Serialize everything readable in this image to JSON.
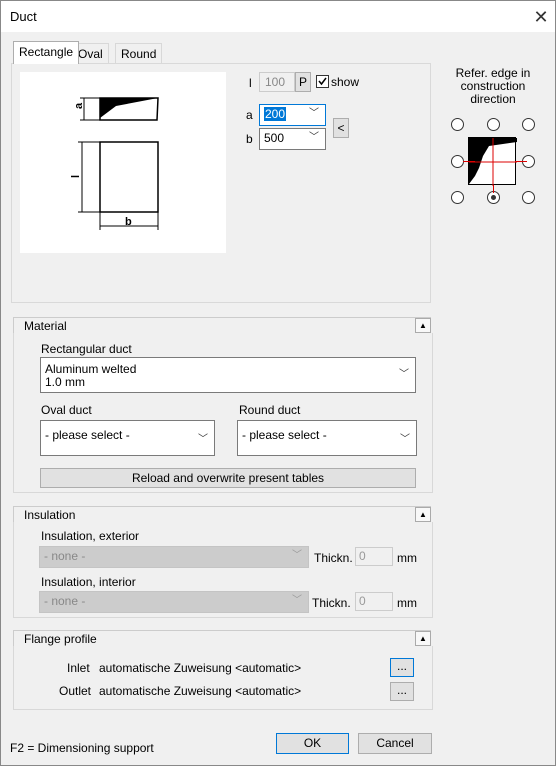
{
  "window": {
    "title": "Duct",
    "close_icon": "close-icon"
  },
  "tabs": [
    {
      "label": "Rectangle",
      "active": true
    },
    {
      "label": "Oval",
      "active": false
    },
    {
      "label": "Round",
      "active": false
    }
  ],
  "dimensions": {
    "l_label": "l",
    "l_value": "100",
    "p_button": "P",
    "show_label": "show",
    "show_checked": true,
    "a_label": "a",
    "a_value": "200",
    "b_label": "b",
    "b_value": "500",
    "swap_button": "<"
  },
  "diagram": {
    "label_a": "a",
    "label_l": "l",
    "label_b": "b"
  },
  "reference": {
    "title": "Refer. edge in construction direction",
    "selected": "bottom-center"
  },
  "material": {
    "title": "Material",
    "rect_label": "Rectangular duct",
    "rect_value_line1": "Aluminum welted",
    "rect_value_line2": "1.0 mm",
    "oval_label": "Oval duct",
    "oval_value": "- please select -",
    "round_label": "Round duct",
    "round_value": "- please select -",
    "reload_button": "Reload and overwrite present tables"
  },
  "insulation": {
    "title": "Insulation",
    "exterior_label": "Insulation, exterior",
    "exterior_value": "- none -",
    "exterior_thickn_label": "Thickn.",
    "exterior_thickn_value": "0",
    "exterior_unit": "mm",
    "interior_label": "Insulation, interior",
    "interior_value": "- none -",
    "interior_thickn_label": "Thickn.",
    "interior_thickn_value": "0",
    "interior_unit": "mm"
  },
  "flange": {
    "title": "Flange profile",
    "inlet_label": "Inlet",
    "inlet_value": "automatische Zuweisung <automatic>",
    "inlet_button": "...",
    "outlet_label": "Outlet",
    "outlet_value": "automatische Zuweisung <automatic>",
    "outlet_button": "..."
  },
  "footer": {
    "hint": "F2 = Dimensioning support",
    "ok": "OK",
    "cancel": "Cancel"
  }
}
